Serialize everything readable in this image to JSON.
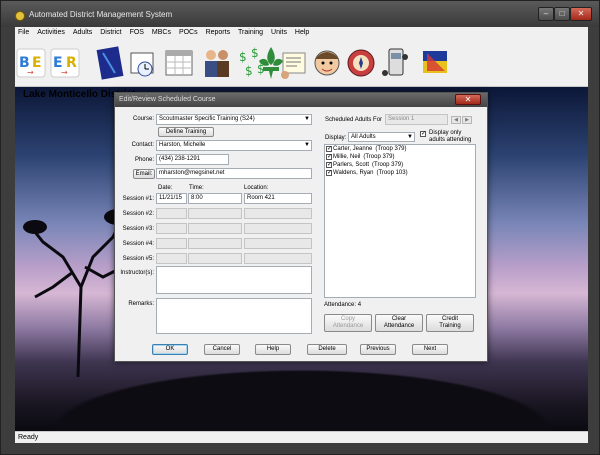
{
  "window": {
    "title": "Automated District Management System"
  },
  "menu": [
    "File",
    "Activities",
    "Adults",
    "District",
    "FOS",
    "MBCs",
    "POCs",
    "Reports",
    "Training",
    "Units",
    "Help"
  ],
  "toolbar_icons": [
    "b-e-icon",
    "e-r-icon",
    "notebook-icon",
    "calendar-clock-icon",
    "calendar-icon",
    "handshake-icon",
    "money-icon",
    "fleur-de-lis-icon",
    "memo-icon",
    "scout-face-icon",
    "medal-icon",
    "phone-icon",
    "flag-icon"
  ],
  "backdrop": {
    "district_label": "Lake Monticello District"
  },
  "dialog": {
    "title": "Edit/Review Scheduled Course",
    "course_label": "Course:",
    "course_value": "Scoutmaster Specific Training  (S24)",
    "define_training": "Define Training",
    "contact_label": "Contact:",
    "contact_value": "Harston,  Michelle",
    "phone_label": "Phone:",
    "phone_value": "(434) 238-1291",
    "email_button": "Email:",
    "email_value": "mharston@megsinet.net",
    "col_date": "Date:",
    "col_time": "Time:",
    "col_location": "Location:",
    "sessions": [
      {
        "label": "Session #1:",
        "date": "11/21/15",
        "time": "8:00",
        "location": "Room 421"
      },
      {
        "label": "Session #2:",
        "date": "",
        "time": "",
        "location": ""
      },
      {
        "label": "Session #3:",
        "date": "",
        "time": "",
        "location": ""
      },
      {
        "label": "Session #4:",
        "date": "",
        "time": "",
        "location": ""
      },
      {
        "label": "Session #5:",
        "date": "",
        "time": "",
        "location": ""
      }
    ],
    "instructors_label": "Instructor(s):",
    "remarks_label": "Remarks:",
    "scheduled_label": "Scheduled Adults For",
    "session_select": "Session 1",
    "display_label": "Display:",
    "display_value": "All Adults",
    "display_only_label_1": "Display only",
    "display_only_label_2": "adults attending",
    "display_only_checked": true,
    "adults": [
      {
        "name": "Carter,  Jeanne",
        "troop": "(Troop 379)",
        "checked": true
      },
      {
        "name": "Millie,  Neil",
        "troop": "(Troop 379)",
        "checked": true
      },
      {
        "name": "Parlers,  Scott",
        "troop": "(Troop 379)",
        "checked": true
      },
      {
        "name": "Waldens,  Ryan",
        "troop": "(Troop 103)",
        "checked": true
      }
    ],
    "attendance": "Attendance: 4",
    "copy_attendance": [
      "Copy",
      "Attendance"
    ],
    "clear_attendance": [
      "Clear",
      "Attendance"
    ],
    "credit_training": [
      "Credit",
      "Training"
    ],
    "buttons": {
      "ok": "OK",
      "cancel": "Cancel",
      "help": "Help",
      "delete": "Delete",
      "previous": "Previous",
      "next": "Next"
    }
  },
  "status": "Ready",
  "colors": {
    "title_bar": "#444444",
    "close_red": "#c0392b",
    "dialog_bg": "#f0f0f0"
  }
}
